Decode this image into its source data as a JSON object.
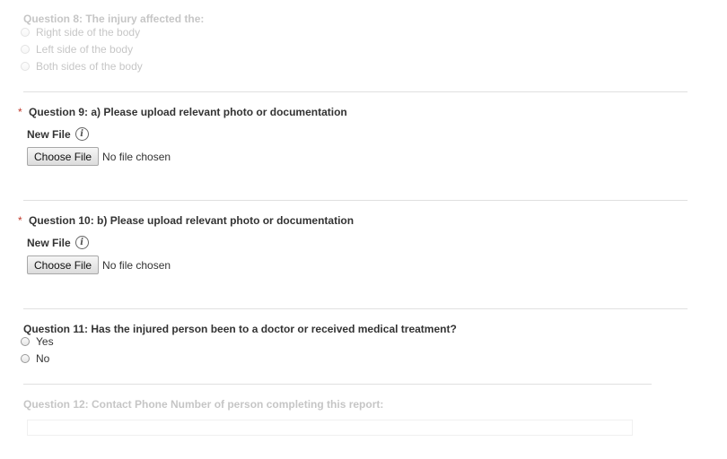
{
  "q8": {
    "title": "Question 8: The injury affected the:",
    "options": [
      "Right side of the body",
      "Left side of the body",
      "Both sides of the body"
    ]
  },
  "q9": {
    "required_mark": "*",
    "title": "Question 9: a) Please upload relevant photo or documentation",
    "new_file_label": "New File",
    "info_icon": "i",
    "button_label": "Choose File",
    "file_status": "No file chosen"
  },
  "q10": {
    "required_mark": "*",
    "title": "Question 10: b) Please upload relevant photo or documentation",
    "new_file_label": "New File",
    "info_icon": "i",
    "button_label": "Choose File",
    "file_status": "No file chosen"
  },
  "q11": {
    "title": "Question 11: Has the injured person been to a doctor or received medical treatment?",
    "options": [
      "Yes",
      "No"
    ]
  },
  "q12": {
    "title": "Question 12: Contact Phone Number of person completing this report:",
    "value": ""
  }
}
